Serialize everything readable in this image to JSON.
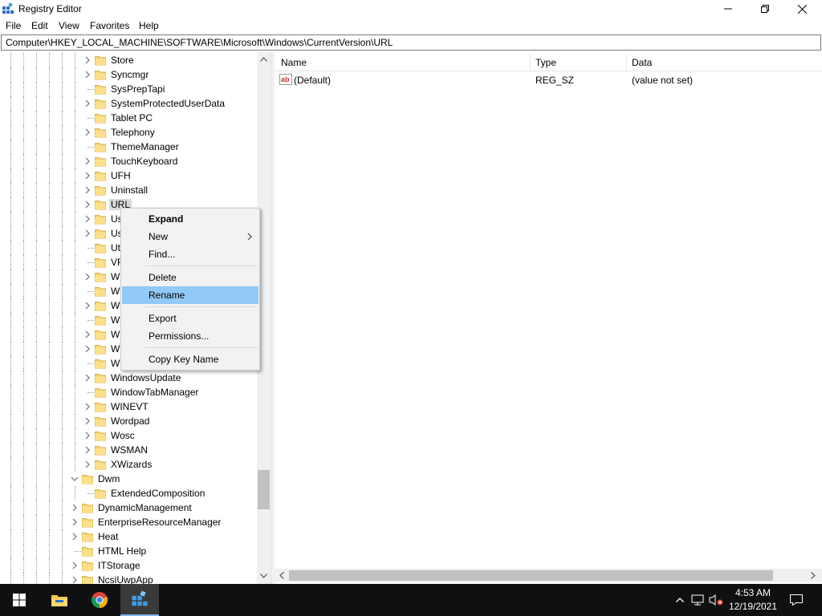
{
  "window": {
    "title": "Registry Editor",
    "buttons": {
      "minimize": "—",
      "maximize": "❐",
      "close": "✕"
    }
  },
  "menu": [
    "File",
    "Edit",
    "View",
    "Favorites",
    "Help"
  ],
  "address": "Computer\\HKEY_LOCAL_MACHINE\\SOFTWARE\\Microsoft\\Windows\\CurrentVersion\\URL",
  "tree": [
    {
      "label": "Store",
      "level": 2,
      "expandable": true
    },
    {
      "label": "Syncmgr",
      "level": 2,
      "expandable": true
    },
    {
      "label": "SysPrepTapi",
      "level": 2,
      "expandable": false
    },
    {
      "label": "SystemProtectedUserData",
      "level": 2,
      "expandable": true
    },
    {
      "label": "Tablet PC",
      "level": 2,
      "expandable": false
    },
    {
      "label": "Telephony",
      "level": 2,
      "expandable": true
    },
    {
      "label": "ThemeManager",
      "level": 2,
      "expandable": false
    },
    {
      "label": "TouchKeyboard",
      "level": 2,
      "expandable": true
    },
    {
      "label": "UFH",
      "level": 2,
      "expandable": true
    },
    {
      "label": "Uninstall",
      "level": 2,
      "expandable": true
    },
    {
      "label": "URL",
      "level": 2,
      "expandable": true,
      "selected": true
    },
    {
      "label": "Us",
      "level": 2,
      "expandable": true
    },
    {
      "label": "Us",
      "level": 2,
      "expandable": true
    },
    {
      "label": "Ut",
      "level": 2,
      "expandable": false
    },
    {
      "label": "VF",
      "level": 2,
      "expandable": false
    },
    {
      "label": "W",
      "level": 2,
      "expandable": true
    },
    {
      "label": "W",
      "level": 2,
      "expandable": false
    },
    {
      "label": "W",
      "level": 2,
      "expandable": true
    },
    {
      "label": "W",
      "level": 2,
      "expandable": false
    },
    {
      "label": "W",
      "level": 2,
      "expandable": true
    },
    {
      "label": "W",
      "level": 2,
      "expandable": true
    },
    {
      "label": "W",
      "level": 2,
      "expandable": false
    },
    {
      "label": "WindowsUpdate",
      "level": 2,
      "expandable": true
    },
    {
      "label": "WindowTabManager",
      "level": 2,
      "expandable": false
    },
    {
      "label": "WINEVT",
      "level": 2,
      "expandable": true
    },
    {
      "label": "Wordpad",
      "level": 2,
      "expandable": true
    },
    {
      "label": "Wosc",
      "level": 2,
      "expandable": true
    },
    {
      "label": "WSMAN",
      "level": 2,
      "expandable": true
    },
    {
      "label": "XWizards",
      "level": 2,
      "expandable": true
    },
    {
      "label": "Dwm",
      "level": 1,
      "expandable": true,
      "expanded": true
    },
    {
      "label": "ExtendedComposition",
      "level": 2,
      "expandable": false
    },
    {
      "label": "DynamicManagement",
      "level": 1,
      "expandable": true
    },
    {
      "label": "EnterpriseResourceManager",
      "level": 1,
      "expandable": true
    },
    {
      "label": "Heat",
      "level": 1,
      "expandable": true
    },
    {
      "label": "HTML Help",
      "level": 1,
      "expandable": false
    },
    {
      "label": "ITStorage",
      "level": 1,
      "expandable": true
    },
    {
      "label": "NcsiUwpApp",
      "level": 1,
      "expandable": true
    }
  ],
  "values": {
    "columns": [
      "Name",
      "Type",
      "Data"
    ],
    "rows": [
      {
        "name": "(Default)",
        "type": "REG_SZ",
        "data": "(value not set)",
        "icon": "string-value-icon"
      }
    ]
  },
  "context_menu": {
    "items": [
      {
        "label": "Expand",
        "bold": true
      },
      {
        "label": "New",
        "submenu": true
      },
      {
        "label": "Find..."
      },
      {
        "separator": true
      },
      {
        "label": "Delete"
      },
      {
        "label": "Rename",
        "hover": true
      },
      {
        "separator": true
      },
      {
        "label": "Export"
      },
      {
        "label": "Permissions..."
      },
      {
        "separator": true
      },
      {
        "label": "Copy Key Name"
      }
    ]
  },
  "taskbar": {
    "time": "4:53 AM",
    "date": "12/19/2021",
    "pinned": [
      "start-button",
      "file-explorer",
      "chrome",
      "registry-editor"
    ]
  },
  "colors": {
    "selection_hover": "#91c9f7",
    "folder": "#f5d778",
    "taskbar_bg": "#101010"
  }
}
